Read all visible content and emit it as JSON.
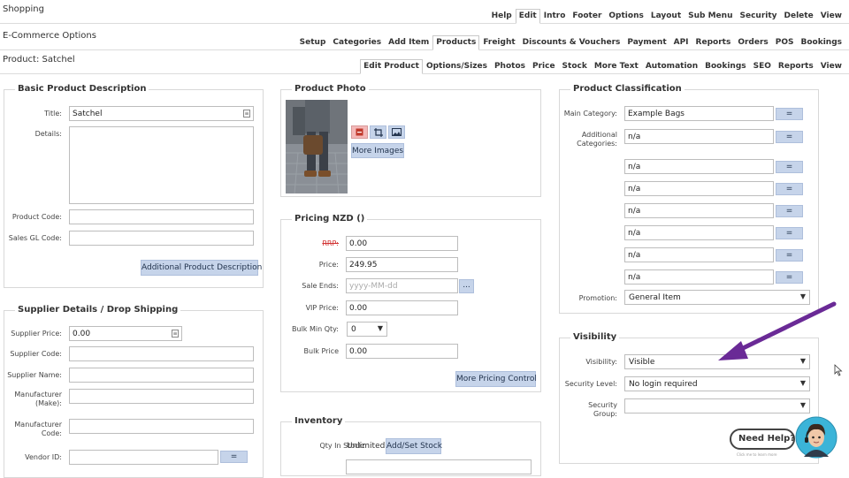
{
  "nav1": {
    "title": "Shopping",
    "items": [
      "Help",
      "Edit",
      "Intro",
      "Footer",
      "Options",
      "Layout",
      "Sub Menu",
      "Security",
      "Delete",
      "View"
    ],
    "active": "Edit"
  },
  "nav2": {
    "title": "E-Commerce Options",
    "items": [
      "Setup",
      "Categories",
      "Add Item",
      "Products",
      "Freight",
      "Discounts & Vouchers",
      "Payment",
      "API",
      "Reports",
      "Orders",
      "POS",
      "Bookings"
    ],
    "active": "Products"
  },
  "nav3": {
    "title": "Product: Satchel",
    "items": [
      "Edit Product",
      "Options/Sizes",
      "Photos",
      "Price",
      "Stock",
      "More Text",
      "Automation",
      "Bookings",
      "SEO",
      "Reports",
      "View"
    ],
    "active": "Edit Product"
  },
  "basic": {
    "heading": "Basic Product Description",
    "title_label": "Title:",
    "title_value": "Satchel",
    "details_label": "Details:",
    "product_code_label": "Product Code:",
    "sales_gl_label": "Sales GL Code:",
    "additional_button": "Additional Product Description"
  },
  "supplier": {
    "heading": "Supplier Details / Drop Shipping",
    "price_label": "Supplier Price:",
    "price_value": "0.00",
    "code_label": "Supplier Code:",
    "name_label": "Supplier Name:",
    "make_label": "Manufacturer (Make):",
    "mcode_label": "Manufacturer Code:",
    "vendor_label": "Vendor ID:",
    "vendor_button": "="
  },
  "photo": {
    "heading": "Product Photo",
    "more_images": "More Images"
  },
  "pricing": {
    "heading": "Pricing NZD ()",
    "rrp_label": "RRP:",
    "rrp_value": "0.00",
    "price_label": "Price:",
    "price_value": "249.95",
    "sale_ends_label": "Sale Ends:",
    "sale_ends_placeholder": "yyyy-MM-dd",
    "date_button": "...",
    "vip_label": "VIP Price:",
    "vip_value": "0.00",
    "bulk_min_label": "Bulk Min Qty:",
    "bulk_min_value": "0",
    "bulk_price_label": "Bulk Price",
    "bulk_price_value": "0.00",
    "more_button": "More Pricing Control"
  },
  "inventory": {
    "heading": "Inventory",
    "qty_label": "Qty In Stock:",
    "qty_value": "Unlimited",
    "add_button": "Add/Set Stock"
  },
  "classification": {
    "heading": "Product Classification",
    "main_label": "Main Category:",
    "main_value": "Example Bags",
    "additional_label": "Additional Categories:",
    "additional_values": [
      "n/a",
      "n/a",
      "n/a",
      "n/a",
      "n/a",
      "n/a",
      "n/a",
      "n/a"
    ],
    "eq_label": "=",
    "promotion_label": "Promotion:",
    "promotion_value": "General Item"
  },
  "visibility": {
    "heading": "Visibility",
    "visibility_label": "Visibility:",
    "visibility_value": "Visible",
    "security_level_label": "Security Level:",
    "security_level_value": "No login required",
    "security_group_label": "Security Group:",
    "security_group_value": ""
  },
  "help": {
    "text": "Need Help?",
    "sub": "Click me to learn more"
  },
  "colors": {
    "button_bg": "#c6d4ea",
    "annotation_arrow": "#6a2a96"
  }
}
